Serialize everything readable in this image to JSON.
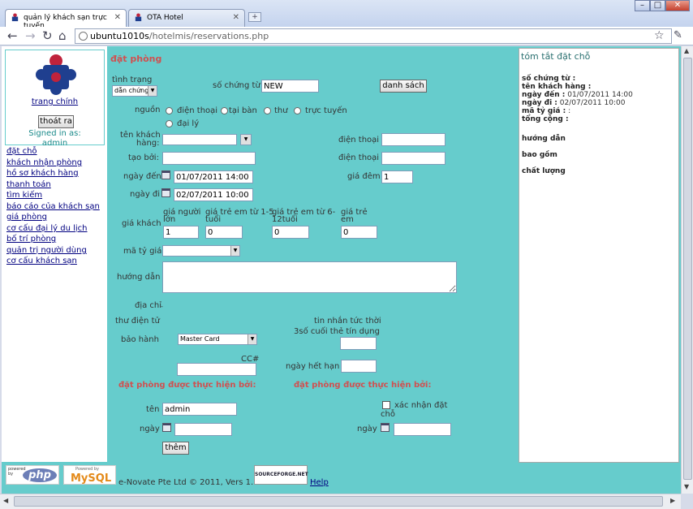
{
  "browser": {
    "tabs": [
      {
        "title": "quản lý khách sạn trực tuyến"
      },
      {
        "title": "OTA Hotel"
      }
    ],
    "url_host": "ubuntu1010s",
    "url_path": "/hotelmis/reservations.php"
  },
  "sidebar": {
    "home_link": "trang chính",
    "logout_button": "thoát ra",
    "signed_in_label": "Signed in as:",
    "username": "admin",
    "links": [
      "đặt chỗ",
      "khách nhận phòng",
      "hồ sơ khách hàng",
      "thanh toán",
      "tìm kiếm",
      "báo cáo của khách sạn",
      "giá phòng",
      "cơ cấu đại lý du lịch",
      "bố trí phòng",
      "quản trị người dùng",
      "cơ cấu khách sạn"
    ]
  },
  "form": {
    "title": "đặt phòng",
    "status_label": "tình trạng",
    "status_value": "dẫn chứng",
    "voucher_label": "số chứng từ",
    "voucher_value": "NEW",
    "list_button": "danh sách",
    "source_label": "nguồn",
    "source_options": [
      "điện thoại",
      "tại bàn",
      "thư",
      "trực tuyến",
      "đại lý"
    ],
    "guest_name_label_1": "tên khách",
    "guest_name_label_2": "hàng:",
    "phone_label_1": "điện thoại",
    "created_by_label": "tạo bởi:",
    "phone_label_2": "điện thoại",
    "checkin_label": "ngày đến",
    "checkin_value": "01/07/2011 14:00",
    "night_price_label": "giá đêm",
    "night_price_value": "1",
    "checkout_label": "ngày đi",
    "checkout_value": "02/07/2011 10:00",
    "guest_price_label": "giá khách",
    "adult_price_label_1": "giá người",
    "adult_price_label_2": "lớn",
    "adult_price_value": "1",
    "child15_label_1": "giá trẻ em từ 1-5",
    "child15_label_2": "tuổi",
    "child15_value": "0",
    "child612_label_1": "giá trẻ em từ 6-",
    "child612_label_2": "12tuổi",
    "child612_value": "0",
    "infant_label_1": "giá trẻ",
    "infant_label_2": "em",
    "infant_value": "0",
    "rate_code_label": "mã tỷ giá",
    "instructions_label": "hướng dẫn",
    "address_label": "địa chỉ",
    "address_value": "-",
    "email_label": "thư điện tử",
    "im_label": "tin nhắn tức thời",
    "warranty_label": "bảo hành",
    "card_value": "Master Card",
    "last3_label": "3số cuối thẻ tín dụng",
    "cc_label": "CC#",
    "expiry_label": "ngày hết hạn",
    "booked_by_heading_1": "đặt phòng được thực hiện bởi:",
    "booked_by_heading_2": "đặt phòng được thực hiện bởi:",
    "name_label": "tên",
    "name_value": "admin",
    "confirm_label_1": "xác nhận đặt",
    "confirm_label_2": "chỗ",
    "date_label_1": "ngày",
    "date_label_2": "ngày",
    "add_button": "thêm"
  },
  "summary": {
    "title": "tóm tắt đặt chỗ",
    "voucher_label": "số chứng từ :",
    "guest_label": "tên khách hàng :",
    "checkin_label": "ngày đến :",
    "checkin_value": "01/07/2011 14:00",
    "checkout_label": "ngày đi :",
    "checkout_value": "02/07/2011 10:00",
    "rate_label": "mã tỷ giá :",
    "rate_value": ":",
    "total_label": "tổng cộng :",
    "instructions_heading": "hướng dẫn",
    "includes_heading": "bao gồm",
    "quality_heading": "chất lượng"
  },
  "footer": {
    "php_logo": "php",
    "php_powered": "powered by",
    "mysql_logo": "MySQL",
    "mysql_powered": "Powered by",
    "copyright": "e-Novate Pte Ltd © 2011, Vers 1.1",
    "sourceforge_logo": "SOURCEFORGE.NET",
    "help_link": "Help"
  },
  "colors": {
    "page_bg": "#66cccc",
    "accent_red": "#d05050",
    "link_blue": "#000080"
  }
}
